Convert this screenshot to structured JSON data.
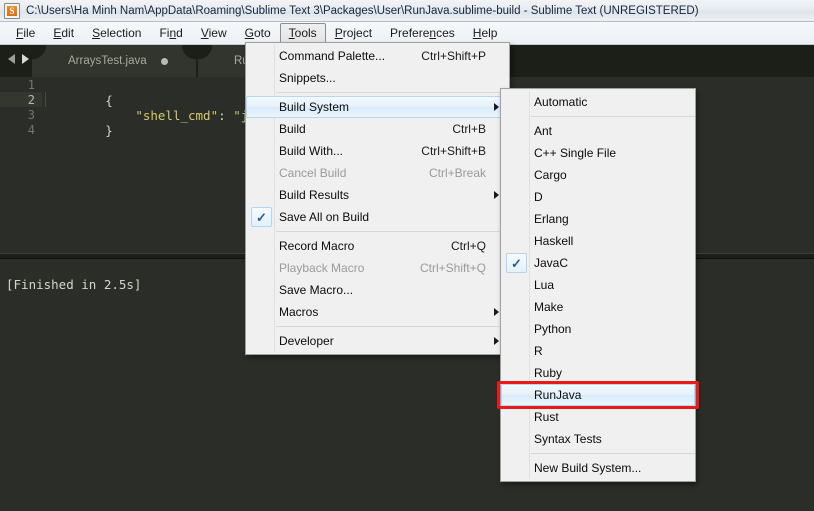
{
  "window": {
    "title": "C:\\Users\\Ha Minh Nam\\AppData\\Roaming\\Sublime Text 3\\Packages\\User\\RunJava.sublime-build - Sublime Text (UNREGISTERED)",
    "icon": "sublime-text-icon",
    "icon_glyph": "S"
  },
  "menubar": {
    "items": [
      {
        "label": "File",
        "accel_index": 0,
        "active": false
      },
      {
        "label": "Edit",
        "accel_index": 0,
        "active": false
      },
      {
        "label": "Selection",
        "accel_index": 0,
        "active": false
      },
      {
        "label": "Find",
        "accel_index": 2,
        "active": false
      },
      {
        "label": "View",
        "accel_index": 0,
        "active": false
      },
      {
        "label": "Goto",
        "accel_index": 0,
        "active": false
      },
      {
        "label": "Tools",
        "accel_index": 0,
        "active": true
      },
      {
        "label": "Project",
        "accel_index": 0,
        "active": false
      },
      {
        "label": "Preferences",
        "accel_index": 7,
        "active": false
      },
      {
        "label": "Help",
        "accel_index": 0,
        "active": false
      }
    ]
  },
  "tabs": [
    {
      "label": "ArraysTest.java",
      "dirty": true,
      "active": false
    },
    {
      "label": "Run",
      "dirty": false,
      "active": true
    }
  ],
  "editor": {
    "line_numbers": [
      "1",
      "2",
      "3",
      "4"
    ],
    "current_line": "2",
    "lines": [
      {
        "n": "1",
        "text": "{"
      },
      {
        "n": "2",
        "key": "\"shell_cmd\"",
        "colon": ": ",
        "value": "\"java $file"
      },
      {
        "n": "3",
        "text": "}"
      },
      {
        "n": "4",
        "text": ""
      }
    ]
  },
  "console": {
    "output": "[Finished in 2.5s]"
  },
  "tools_menu": {
    "title": "Tools",
    "items": [
      {
        "label": "Command Palette...",
        "accel": "Ctrl+Shift+P",
        "type": "item"
      },
      {
        "label": "Snippets...",
        "accel": "",
        "type": "item"
      },
      {
        "type": "separator"
      },
      {
        "label": "Build System",
        "accel": "",
        "type": "submenu",
        "highlighted": true
      },
      {
        "label": "Build",
        "accel": "Ctrl+B",
        "type": "item"
      },
      {
        "label": "Build With...",
        "accel": "Ctrl+Shift+B",
        "type": "item"
      },
      {
        "label": "Cancel Build",
        "accel": "Ctrl+Break",
        "type": "item",
        "disabled": true
      },
      {
        "label": "Build Results",
        "accel": "",
        "type": "submenu"
      },
      {
        "label": "Save All on Build",
        "accel": "",
        "type": "item",
        "checked": true
      },
      {
        "type": "separator"
      },
      {
        "label": "Record Macro",
        "accel": "Ctrl+Q",
        "type": "item"
      },
      {
        "label": "Playback Macro",
        "accel": "Ctrl+Shift+Q",
        "type": "item",
        "disabled": true
      },
      {
        "label": "Save Macro...",
        "accel": "",
        "type": "item"
      },
      {
        "label": "Macros",
        "accel": "",
        "type": "submenu"
      },
      {
        "type": "separator"
      },
      {
        "label": "Developer",
        "accel": "",
        "type": "submenu"
      }
    ]
  },
  "build_system_menu": {
    "title": "Build System",
    "items": [
      {
        "label": "Automatic",
        "type": "item"
      },
      {
        "type": "separator"
      },
      {
        "label": "Ant",
        "type": "item"
      },
      {
        "label": "C++ Single File",
        "type": "item"
      },
      {
        "label": "Cargo",
        "type": "item"
      },
      {
        "label": "D",
        "type": "item"
      },
      {
        "label": "Erlang",
        "type": "item"
      },
      {
        "label": "Haskell",
        "type": "item"
      },
      {
        "label": "JavaC",
        "type": "item",
        "checked": true
      },
      {
        "label": "Lua",
        "type": "item"
      },
      {
        "label": "Make",
        "type": "item"
      },
      {
        "label": "Python",
        "type": "item"
      },
      {
        "label": "R",
        "type": "item"
      },
      {
        "label": "Ruby",
        "type": "item"
      },
      {
        "label": "RunJava",
        "type": "item",
        "highlighted": true,
        "annotated": true
      },
      {
        "label": "Rust",
        "type": "item"
      },
      {
        "label": "Syntax Tests",
        "type": "item"
      },
      {
        "type": "separator"
      },
      {
        "label": "New Build System...",
        "type": "item"
      }
    ]
  },
  "annotation": {
    "name": "red-highlight-box",
    "target": "RunJava",
    "color": "#e81a1a"
  },
  "colors": {
    "editor_bg": "#2b2d28",
    "tabbar_bg": "#1c1e18",
    "tab_active_bg": "#32352d",
    "menu_bg": "#f0f0f0",
    "menu_highlight": "#d8ebfa",
    "string_green": "#b2cf6b",
    "key_yellow": "#d6c96a",
    "annotation_red": "#e81a1a"
  }
}
